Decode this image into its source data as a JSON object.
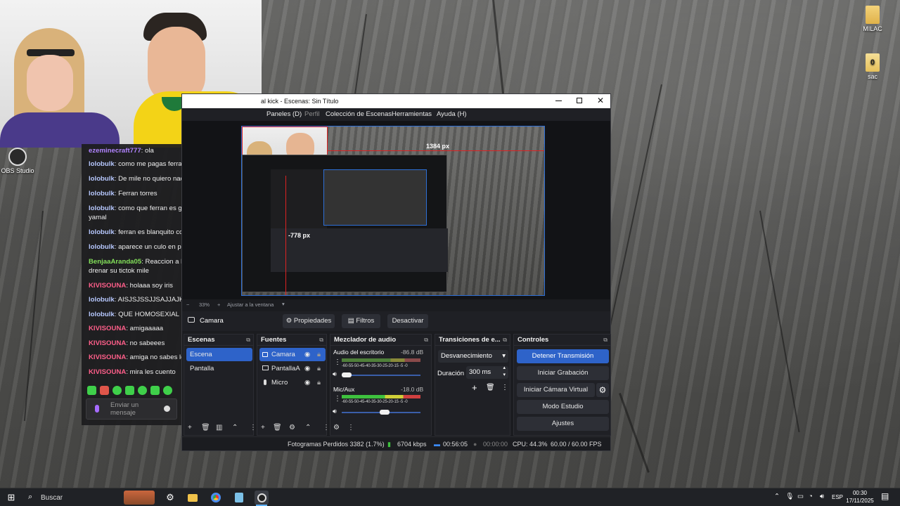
{
  "desktop": {
    "icons": [
      {
        "label": "MILAC",
        "kind": "folder"
      },
      {
        "label": "sac",
        "kind": "file",
        "glyph": "0"
      },
      {
        "label": "OBS Studio",
        "kind": "app"
      }
    ]
  },
  "chat": {
    "messages": [
      {
        "user": "ezeminecraft777",
        "text": ": ola",
        "color": "#b083ff"
      },
      {
        "user": "lolobulk",
        "text": ": como me pagas ferran",
        "color": "#b7c8ff"
      },
      {
        "user": "lolobulk",
        "text": ": De mile no quiero nada",
        "color": "#b7c8ff"
      },
      {
        "user": "lolobulk",
        "text": ": Ferran torres",
        "color": "#b7c8ff"
      },
      {
        "user": "lolobulk",
        "text": ": como que ferran es gr",
        "color": "#b7c8ff"
      },
      {
        "user": "",
        "text": "yamal",
        "color": "#b7c8ff"
      },
      {
        "user": "lolobulk",
        "text": ": ferran es blanquito cor",
        "color": "#b7c8ff"
      },
      {
        "user": "lolobulk",
        "text": ": aparece un culo en pri",
        "color": "#b7c8ff"
      },
      {
        "user": "BenjaaAranda05",
        "text": ": Reaccion a lo",
        "color": "#83e05a"
      },
      {
        "user": "",
        "text": "drenar su tictok mile",
        "color": "#83e05a"
      },
      {
        "user": "KIVISOUNA",
        "text": ": holaaa soy iris",
        "color": "#ff5f8a"
      },
      {
        "user": "lolobulk",
        "text": ": AISJSJSSJJSAJJAJKI",
        "color": "#b7c8ff"
      },
      {
        "user": "lolobulk",
        "text": ": QUE HOMOSEXIAL",
        "color": "#b7c8ff"
      },
      {
        "user": "KIVISOUNA",
        "text": ": amigaaaaa",
        "color": "#ff5f8a"
      },
      {
        "user": "KIVISOUNA",
        "text": ": no sabeees",
        "color": "#ff5f8a"
      },
      {
        "user": "KIVISOUNA",
        "text": ": amiga no sabes lo",
        "color": "#ff5f8a"
      },
      {
        "user": "KIVISOUNA",
        "text": ": mira les cuento",
        "color": "#ff5f8a"
      }
    ],
    "input_placeholder": "Enviar un mensaje"
  },
  "obs": {
    "title": "al kick - Escenas: Sin Título",
    "menu": [
      "Paneles (D)",
      "Perfil",
      "Colección de Escenas",
      "Herramientas",
      "Ayuda (H)"
    ],
    "preview": {
      "width_label": "1384 px",
      "height_label": "-778 px"
    },
    "zoom": {
      "minus": "−",
      "value": "33%",
      "plus": "+",
      "fit": "Ajustar a la ventana"
    },
    "source_toolbar": {
      "source_name": "Camara",
      "properties": "Propiedades",
      "filters": "Filtros",
      "deactivate": "Desactivar"
    },
    "docks": {
      "scenes": {
        "title": "Escenas",
        "items": [
          "Escena",
          "Pantalla"
        ]
      },
      "sources": {
        "title": "Fuentes",
        "items": [
          "Camara",
          "PantallaA",
          "Micro"
        ]
      },
      "mixer": {
        "title": "Mezclador de audio",
        "channels": [
          {
            "name": "Audio del escritorio",
            "db": "-86.8 dB",
            "level": 0.12
          },
          {
            "name": "Mic/Aux",
            "db": "-18.0 dB",
            "level": 0.63
          }
        ],
        "scale": "-60-55-50-45-40-35-30-25-20-15 -5 -0"
      },
      "transitions": {
        "title": "Transiciones de e...",
        "selected": "Desvanecimiento",
        "duration_label": "Duración",
        "duration_value": "300 ms"
      },
      "controls": {
        "title": "Controles",
        "buttons": [
          "Detener Transmisión",
          "Iniciar Grabación",
          "Iniciar Cámara Virtual",
          "Modo Estudio",
          "Ajustes"
        ]
      }
    },
    "status": {
      "dropped_frames": "Fotogramas Perdidos 3382 (1.7%)",
      "bitrate": "6704 kbps",
      "stream_time": "00:56:05",
      "rec_time": "00:00:00",
      "cpu": "CPU: 44.3%",
      "fps": "60.00 / 60.00 FPS"
    }
  },
  "taskbar": {
    "search": "Buscar",
    "lang": "ESP",
    "time": "00:30",
    "date": "17/11/2025"
  }
}
